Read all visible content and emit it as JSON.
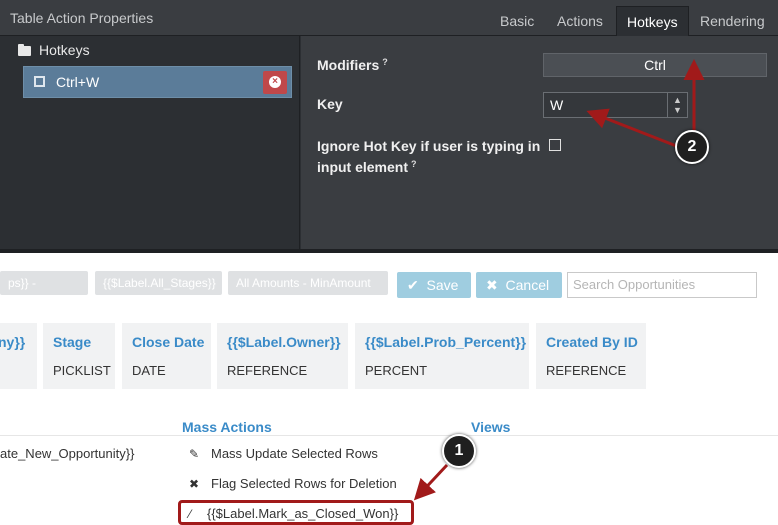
{
  "panel": {
    "title": "Table Action Properties",
    "tabs": [
      "Basic",
      "Actions",
      "Hotkeys",
      "Rendering"
    ],
    "active_tab": "Hotkeys",
    "tree_heading": "Hotkeys",
    "selected_hotkey": "Ctrl+W",
    "modifiers_label": "Modifiers",
    "modifiers_value": "Ctrl",
    "key_label": "Key",
    "key_value": "W",
    "ignore_label_line1": "Ignore Hot Key if user is typing in",
    "ignore_label_line2": "input element",
    "help_glyph": "?"
  },
  "toolbar": {
    "chips": [
      "ps}} - OwnerId",
      "{{$Label.All_Stages}}",
      "All Amounts - MinAmount"
    ],
    "save_label": "Save",
    "cancel_label": "Cancel",
    "search_placeholder": "Search Opportunities"
  },
  "fields": [
    {
      "header": "ny}}",
      "type": ""
    },
    {
      "header": "Stage",
      "type": "PICKLIST"
    },
    {
      "header": "Close Date",
      "type": "DATE"
    },
    {
      "header": "{{$Label.Owner}}",
      "type": "REFERENCE"
    },
    {
      "header": "{{$Label.Prob_Percent}}",
      "type": "PERCENT"
    },
    {
      "header": "Created By ID",
      "type": "REFERENCE"
    }
  ],
  "sections": {
    "mass_actions_title": "Mass Actions",
    "views_title": "Views",
    "left_fragment": "ate_New_Opportunity}}",
    "mass_actions": [
      {
        "label": "Mass Update Selected Rows",
        "icon": "edit-icon"
      },
      {
        "label": "Flag Selected Rows for Deletion",
        "icon": "remove-circle-icon"
      },
      {
        "label": "{{$Label.Mark_as_Closed_Won}}",
        "icon": "magic-wand-icon"
      }
    ]
  },
  "annotations": {
    "badge_1": "1",
    "badge_2": "2",
    "color": "#a11a1a"
  }
}
